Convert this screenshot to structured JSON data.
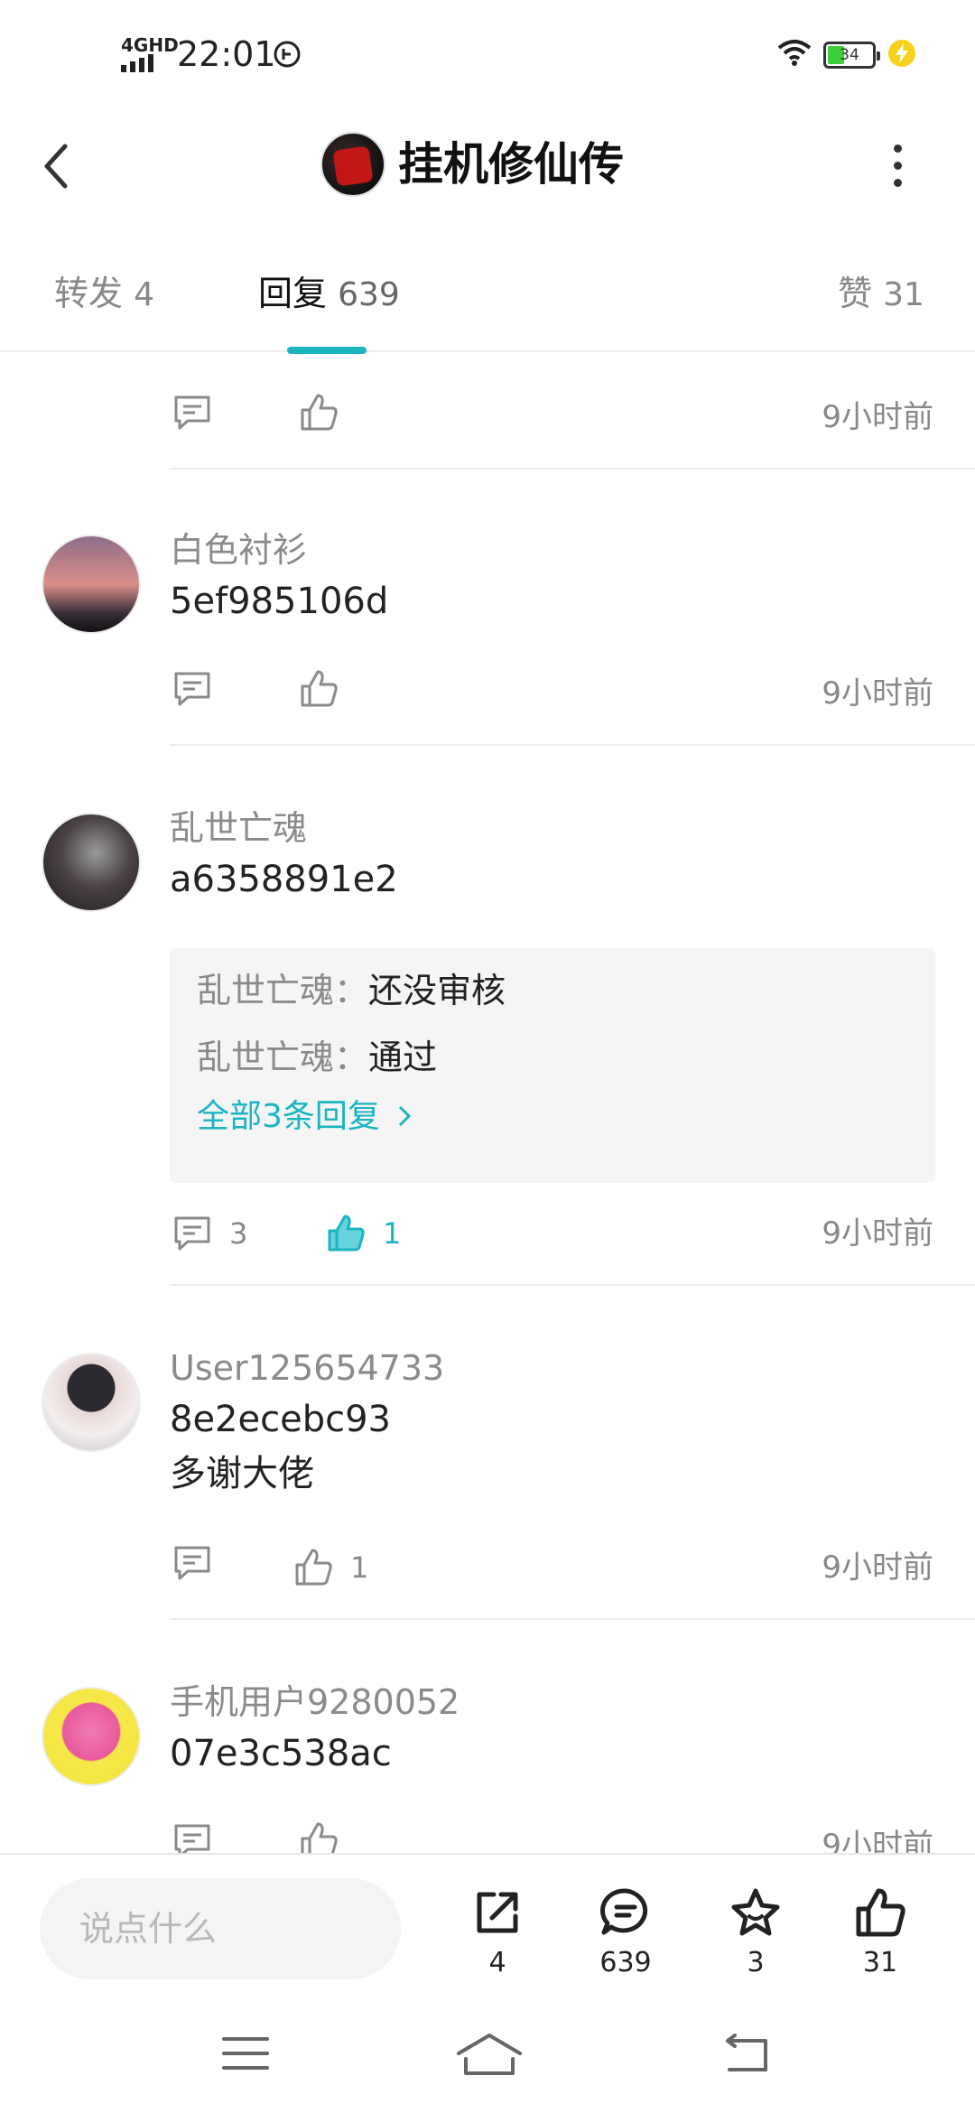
{
  "status_bar": {
    "network": "4GHD",
    "time": "22:01",
    "battery": "34"
  },
  "header": {
    "title": "挂机修仙传"
  },
  "tabs": [
    {
      "label": "转发",
      "count": "4"
    },
    {
      "label": "回复",
      "count": "639"
    },
    {
      "label": "赞",
      "count": "31"
    }
  ],
  "comments": [
    {
      "username": "",
      "text": "",
      "reply_count": "",
      "like_count": "",
      "time": "9小时前"
    },
    {
      "username": "白色衬衫",
      "text": "5ef985106d",
      "reply_count": "",
      "like_count": "",
      "time": "9小时前"
    },
    {
      "username": "乱世亡魂",
      "text": "a6358891e2",
      "sub_replies": [
        {
          "user": "乱世亡魂",
          "text": "还没审核"
        },
        {
          "user": "乱世亡魂",
          "text": "通过"
        }
      ],
      "view_all": "全部3条回复",
      "reply_count": "3",
      "like_count": "1",
      "time": "9小时前"
    },
    {
      "username": "User125654733",
      "text_lines": [
        "8e2ecebc93",
        "多谢大佬"
      ],
      "reply_count": "",
      "like_count": "1",
      "time": "9小时前"
    },
    {
      "username": "手机用户9280052",
      "text": "07e3c538ac",
      "time": "9小时前"
    }
  ],
  "bottom_bar": {
    "input_placeholder": "说点什么",
    "share_count": "4",
    "comment_count": "639",
    "favorite_count": "3",
    "like_count": "31"
  },
  "colors": {
    "accent": "#1bb5c2",
    "muted": "#8a8a8a"
  }
}
